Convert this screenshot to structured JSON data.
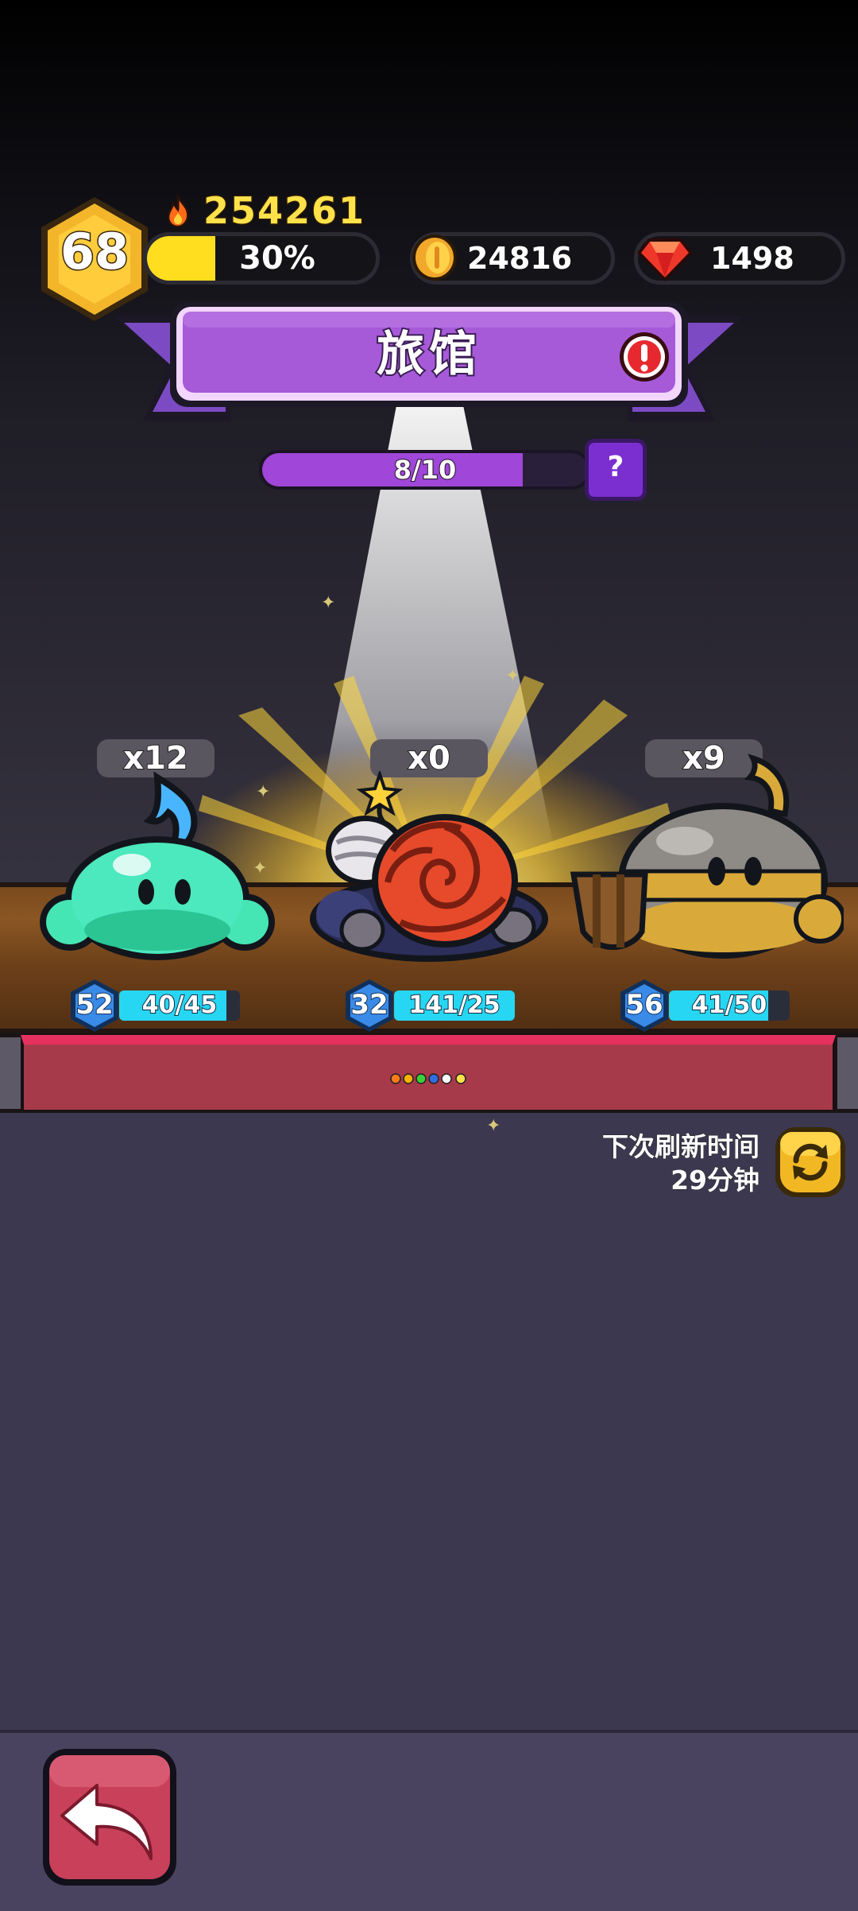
{
  "header": {
    "level": "68",
    "power": "254261",
    "exp_percent_label": "30%",
    "exp_fraction": 0.3,
    "coins": "24816",
    "gems": "1498"
  },
  "title": {
    "text": "旅馆"
  },
  "progress": {
    "label": "8/10",
    "fraction": 0.8,
    "help_label": "?"
  },
  "monsters": [
    {
      "name": "green-slime",
      "count": "x12",
      "level": "52",
      "hp": "40/45",
      "hp_fraction": 0.89
    },
    {
      "name": "bomb-snail",
      "count": "x0",
      "level": "32",
      "hp": "141/25",
      "hp_fraction": 1.0
    },
    {
      "name": "armored-slime",
      "count": "x9",
      "level": "56",
      "hp": "41/50",
      "hp_fraction": 0.82
    }
  ],
  "refresh": {
    "label": "下次刷新时间",
    "time": "29分钟"
  },
  "colors": {
    "accent_purple": "#a046d8",
    "hp_cyan": "#27d6f2",
    "gold": "#ffde1f",
    "shelf_red": "#a73a4a",
    "back_button": "#c9405a"
  },
  "icons": {
    "power": "flame-icon",
    "coin": "coin-icon",
    "gem": "ruby-icon",
    "alert": "exclamation-icon",
    "refresh": "refresh-icon",
    "back": "back-arrow-icon"
  }
}
